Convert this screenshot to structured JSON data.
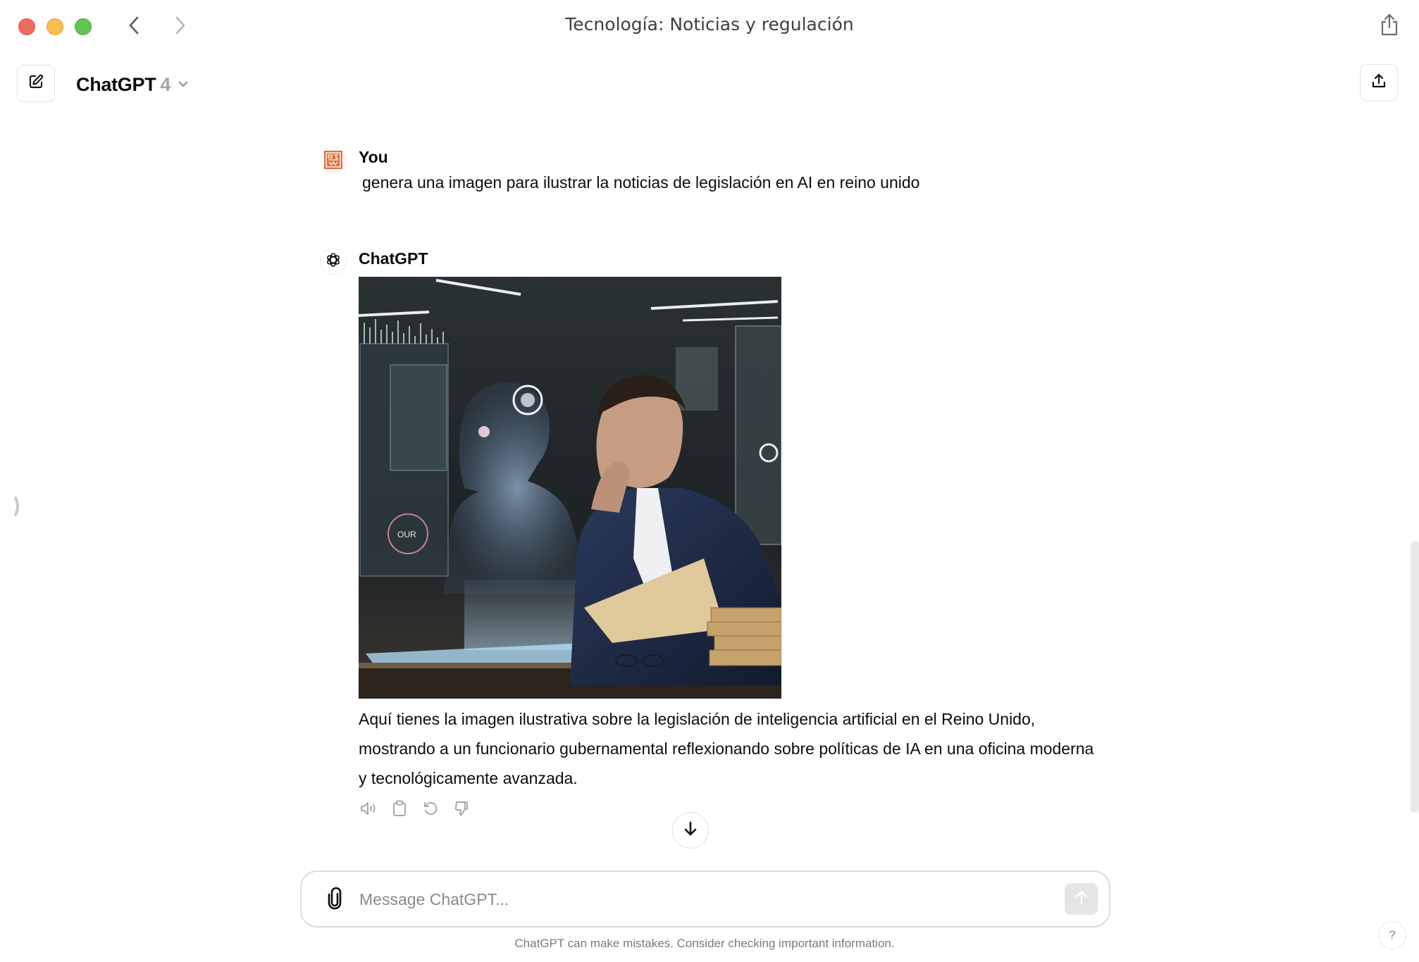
{
  "window": {
    "title": "Tecnología: Noticias y regulación",
    "controls": [
      "close",
      "minimize",
      "maximize"
    ],
    "nav": {
      "back_icon": "chevron-left-icon",
      "forward_icon": "chevron-right-icon"
    },
    "share_icon": "share-icon"
  },
  "header": {
    "new_chat_icon": "edit-icon",
    "model_name": "ChatGPT",
    "model_version": "4",
    "model_dropdown_icon": "chevron-down-icon",
    "share_icon": "upload-icon"
  },
  "sidebar": {
    "toggle_icon": "sidebar-open-icon"
  },
  "conversation": {
    "messages": [
      {
        "author": "You",
        "avatar": "user-avatar-orange",
        "text": "genera una imagen para ilustrar la noticias de legislación en AI en reino unido"
      },
      {
        "author": "ChatGPT",
        "avatar": "openai-logo-icon",
        "image": {
          "description": "Man in navy suit thinking with hand on chin, beside a holographic AI human figure, in a futuristic office with screens and stacks of paper",
          "hologram_label": "OUR"
        },
        "text": "Aquí tienes la imagen ilustrativa sobre la legislación de inteligencia artificial en el Reino Unido, mostrando a un funcionario gubernamental reflexionando sobre políticas de IA en una oficina moderna y tecnológicamente avanzada.",
        "actions": [
          {
            "name": "read-aloud",
            "icon": "speaker-icon"
          },
          {
            "name": "copy",
            "icon": "clipboard-icon"
          },
          {
            "name": "regenerate",
            "icon": "refresh-icon"
          },
          {
            "name": "bad-response",
            "icon": "thumbs-down-icon"
          }
        ]
      }
    ],
    "scroll_down_icon": "arrow-down-icon"
  },
  "composer": {
    "placeholder": "Message ChatGPT...",
    "value": "",
    "attach_icon": "paperclip-icon",
    "send_icon": "arrow-up-icon"
  },
  "footer": {
    "disclaimer": "ChatGPT can make mistakes. Consider checking important information.",
    "help_label": "?"
  },
  "colors": {
    "user_avatar": "#e0703a",
    "send_button_disabled": "#e5e5e5",
    "text_primary": "#0d0d0d",
    "text_muted": "#7a7a7a"
  }
}
